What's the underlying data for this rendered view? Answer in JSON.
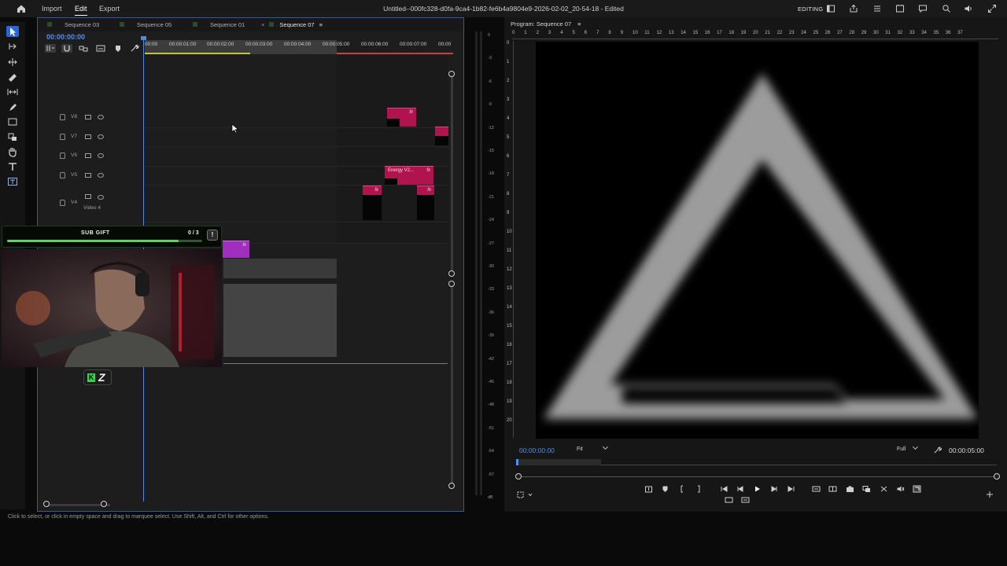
{
  "menu": {
    "import": "Import",
    "edit": "Edit",
    "export": "Export"
  },
  "doc_title": "Untitled--000fc328-d0fa-9ca4-1b82-fe6b4a9804e9-2026-02-02_20-54-18 - Edited",
  "workspace": "EDITING",
  "sequence_tabs": [
    "Sequence 03",
    "Sequence 05",
    "Sequence 01",
    "Sequence 07"
  ],
  "timeline": {
    "timecode": "00:00:00:00",
    "ruler": [
      "00:00",
      "00:00:01:00",
      "00:00:02:00",
      "00:00:03:00",
      "00:00:04:00",
      "00:00:05:00",
      "00:00:06:00",
      "00:00:07:00",
      "00:00"
    ],
    "tracks": [
      "V8",
      "V7",
      "V6",
      "V5",
      "V4"
    ],
    "track_v4_name": "Video 4",
    "clip_energy": "Energy V2...",
    "fx": "fx"
  },
  "webcam": {
    "label": "SUB GIFT",
    "count": "0 / 3",
    "progress": 0.88,
    "badge": "Z"
  },
  "meter": {
    "labels": [
      "0",
      "-3",
      "-6",
      "-9",
      "-12",
      "-15",
      "-18",
      "-21",
      "-24",
      "-27",
      "-30",
      "-33",
      "-36",
      "-39",
      "-42",
      "-45",
      "-48",
      "-51",
      "-54",
      "-57",
      "dB"
    ]
  },
  "program": {
    "title": "Program: Sequence 07",
    "timecode": "00:00:00:00",
    "fit": "Fit",
    "resolution": "Full",
    "duration": "00:00:05:00",
    "hruler": [
      "0",
      "1",
      "2",
      "3",
      "4",
      "5",
      "6",
      "7",
      "8",
      "9",
      "10",
      "11",
      "12",
      "13",
      "14",
      "15",
      "16",
      "17",
      "18",
      "19",
      "20",
      "21",
      "22",
      "23",
      "24",
      "25",
      "26",
      "27",
      "28",
      "29",
      "30",
      "31",
      "32",
      "33",
      "34",
      "35",
      "36",
      "37"
    ]
  },
  "status": "Click to select, or click in empty space and drag to marquee select. Use Shift, Alt, and Ctrl for other options.",
  "colors": {
    "accent": "#4f8ff0",
    "clip_pink": "#b0144e",
    "clip_purple": "#a12fbd",
    "panel_border": "#2b5aa8"
  }
}
